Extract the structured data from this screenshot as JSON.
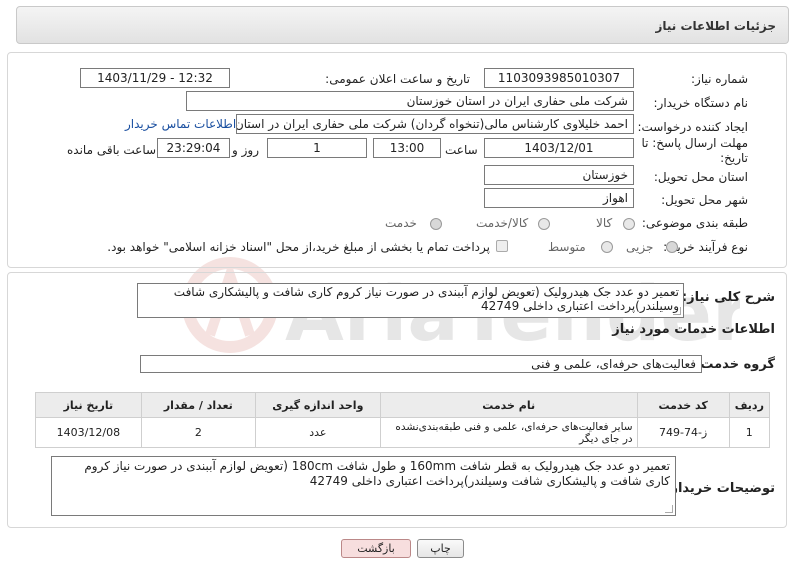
{
  "header": {
    "title": "جزئیات اطلاعات نیاز"
  },
  "form": {
    "need_number_label": "شماره نیاز:",
    "need_number": "1103093985010307",
    "announce_label": "تاریخ و ساعت اعلان عمومی:",
    "announce_value": "1403/11/29 - 12:32",
    "buyer_org_label": "نام دستگاه خریدار:",
    "buyer_org": "شرکت ملی حفاری ایران در استان خوزستان",
    "creator_label": "ایجاد کننده درخواست:",
    "creator": "احمد خلیلاوی کارشناس مالی(تنخواه گردان) شرکت ملی حفاری ایران در استان",
    "contact_link": "اطلاعات تماس خریدار",
    "deadline_label": "مهلت ارسال پاسخ: تا تاریخ:",
    "deadline_date": "1403/12/01",
    "time_label": "ساعت",
    "deadline_time": "13:00",
    "days_value": "1",
    "days_label": "روز و",
    "remaining_time": "23:29:04",
    "remaining_label": "ساعت باقی مانده",
    "province_label": "استان محل تحویل:",
    "province": "خوزستان",
    "city_label": "شهر محل تحویل:",
    "city": "اهواز",
    "category_label": "طبقه بندی موضوعی:",
    "category_options": [
      "کالا",
      "کالا/خدمت",
      "خدمت"
    ],
    "category_selected": "خدمت",
    "process_label": "نوع فرآیند خرید :",
    "process_options": [
      "جزیی",
      "متوسط"
    ],
    "process_selected": "جزیی",
    "payment_text": "پرداخت تمام یا بخشی از مبلغ خرید،از محل \"اسناد خزانه اسلامی\" خواهد بود."
  },
  "summary": {
    "label": "شرح کلی نیاز:",
    "text": "تعمیر دو عدد جک هیدرولیک (تعویض لوازم آببندی در صورت نیاز کروم کاری شافت و پالیشکاری شافت وسیلندر)پرداخت اعتباری داخلی 42749"
  },
  "services": {
    "heading": "اطلاعات خدمات مورد نیاز",
    "group_label": "گروه خدمت:",
    "group_value": "فعالیت‌های حرفه‌ای، علمی و فنی",
    "columns": [
      "ردیف",
      "کد خدمت",
      "نام خدمت",
      "واحد اندازه گیری",
      "تعداد / مقدار",
      "تاریخ نیاز"
    ],
    "rows": [
      [
        "1",
        "ز-74-749",
        "سایر فعالیت‌های حرفه‌ای، علمی و فنی طبقه‌بندی‌نشده در جای دیگر",
        "عدد",
        "2",
        "1403/12/08"
      ]
    ]
  },
  "buyer_notes": {
    "label": "توضیحات خریدار:",
    "text": "تعمیر دو عدد جک هیدرولیک به قطر شافت 160mm و طول شافت 180cm (تعویض لوازم آببندی در صورت نیاز کروم کاری شافت و پالیشکاری شافت وسیلندر)پرداخت اعتباری داخلی 42749"
  },
  "buttons": {
    "print": "چاپ",
    "back": "بازگشت"
  },
  "watermark": {
    "text": "AriaTender.neT"
  },
  "colors": {
    "link": "#1a4fa0",
    "back_button": "#f7dede",
    "watermark": "#c0392b"
  }
}
